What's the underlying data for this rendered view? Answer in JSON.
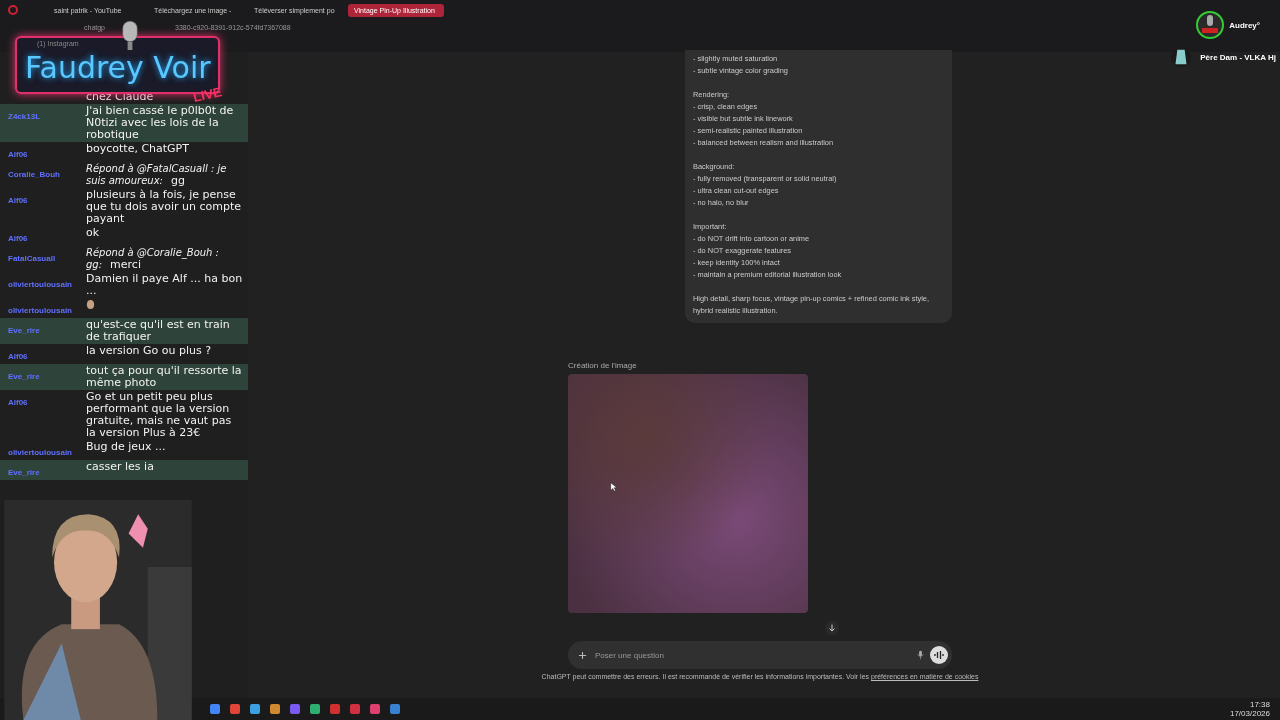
{
  "browser": {
    "tabs": [
      {
        "label": "saint patrik - YouTube",
        "selected": false
      },
      {
        "label": "Téléchargez une image -",
        "selected": false
      },
      {
        "label": "Téléverser simplement po",
        "selected": false
      },
      {
        "label": "Vintage Pin-Up Illustration",
        "selected": true
      }
    ],
    "url_start": "chatgp",
    "url_end": "3380-c920-8391-912c-574fd7367088",
    "bookmarks": "(1) Instagram"
  },
  "overlay": {
    "logo": "Faudrey Voir",
    "logo_badge": "LIVE"
  },
  "chat": [
    {
      "text": "chez Claude",
      "highlight": false
    },
    {
      "user": "Z4ck13L",
      "text": "J'ai bien cassé le p0lb0t de N0tizi avec les lois de la robotique",
      "highlight": true
    },
    {
      "user": "Alf06",
      "text": "boycotte, ChatGPT",
      "highlight": false
    },
    {
      "user": "Coralie_Bouh",
      "quote": "Répond à @FatalCasuall  : je suis amoureux:",
      "text": "gg",
      "highlight": false
    },
    {
      "user": "Alf06",
      "text": "plusieurs à la fois, je pense que tu dois avoir un compte payant",
      "highlight": false
    },
    {
      "user": "Alf06",
      "text": "ok",
      "highlight": false
    },
    {
      "user": "FatalCasuall",
      "quote": "Répond à @Coralie_Bouh  : gg:",
      "text": "merci",
      "highlight": false
    },
    {
      "user": "oliviertoulousain",
      "text": "Damien il paye Alf ... ha bon ...",
      "highlight": false
    },
    {
      "user": "oliviertoulousain",
      "highlight": false
    },
    {
      "user": "Eve_rire",
      "text": "qu'est-ce qu'il est en train de trafiquer",
      "highlight": true
    },
    {
      "user": "Alf06",
      "text": "la version Go ou plus ?",
      "highlight": false
    },
    {
      "user": "Eve_rire",
      "text": "tout ça pour qu'il ressorte la même photo",
      "highlight": true
    },
    {
      "user": "Alf06",
      "text": "Go et un petit peu plus performant que la version gratuite, mais ne vaut pas la version Plus à 23€",
      "highlight": false
    },
    {
      "user": "oliviertoulousain",
      "text": "Bug de jeux ...",
      "highlight": false
    },
    {
      "user": "Eve_rire",
      "text": "casser les ia",
      "highlight": true
    }
  ],
  "profile": {
    "name": "Audrey°",
    "channel": "Père Dam - VLKA Hj"
  },
  "prompt_blocks": [
    [
      "- slightly muted saturation",
      "- subtle vintage color grading"
    ],
    [
      "Rendering:",
      "- crisp, clean edges",
      "- visible but subtle ink linework",
      "- semi-realistic painted illustration",
      "- balanced between realism and illustration"
    ],
    [
      "Background:",
      "- fully removed (transparent or solid neutral)",
      "- ultra clean cut-out edges",
      "- no halo, no blur"
    ],
    [
      "Important:",
      "- do NOT drift into cartoon or anime",
      "- do NOT exaggerate features",
      "- keep identity 100% intact",
      "- maintain a premium editorial illustration look"
    ],
    [
      "High detail, sharp focus, vintage pin-up comics + refined comic ink style, hybrid realistic illustration."
    ]
  ],
  "image_status": "Création de l'image",
  "composer": {
    "placeholder": "Poser une question"
  },
  "disclaimer": "ChatGPT peut commettre des erreurs. Il est recommandé de vérifier les informations importantes. Voir les",
  "disclaimer_link": "préférences en matière de cookies",
  "taskbar": {
    "time": "17:38",
    "date": "17/03/2026"
  }
}
